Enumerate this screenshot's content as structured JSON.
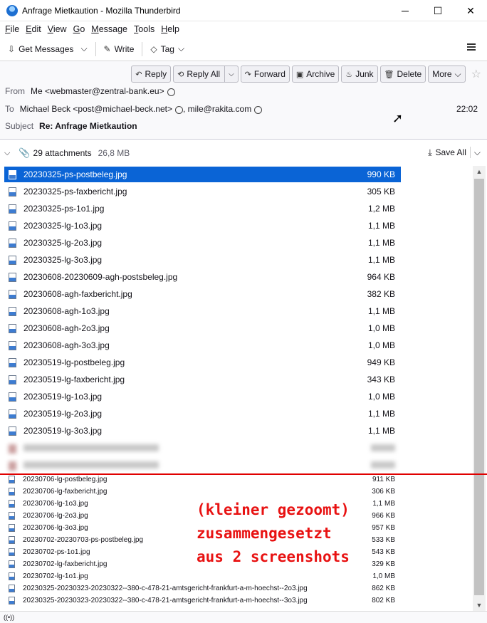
{
  "window": {
    "title": "Anfrage Mietkaution - Mozilla Thunderbird",
    "minimize": "─",
    "maximize": "☐",
    "close": "✕"
  },
  "menu": [
    "File",
    "Edit",
    "View",
    "Go",
    "Message",
    "Tools",
    "Help"
  ],
  "toolbar": {
    "get_messages": "Get Messages",
    "write": "Write",
    "tag": "Tag"
  },
  "actions": {
    "reply": "Reply",
    "reply_all": "Reply All",
    "forward": "Forward",
    "archive": "Archive",
    "junk": "Junk",
    "delete": "Delete",
    "more": "More"
  },
  "header": {
    "from_label": "From",
    "from_value": "Me <webmaster@zentral-bank.eu>",
    "to_label": "To",
    "to_value_1": "Michael Beck <post@michael-beck.net>",
    "to_value_2": ", mile@rakita.com",
    "subject_label": "Subject",
    "subject_value": "Re: Anfrage Mietkaution",
    "time": "22:02"
  },
  "attachments": {
    "count_label": "29 attachments",
    "total_size": "26,8 MB",
    "save_all": "Save All"
  },
  "files": [
    {
      "name": "20230325-ps-postbeleg.jpg",
      "size": "990 KB"
    },
    {
      "name": "20230325-ps-faxbericht.jpg",
      "size": "305 KB"
    },
    {
      "name": "20230325-ps-1o1.jpg",
      "size": "1,2 MB"
    },
    {
      "name": "20230325-lg-1o3.jpg",
      "size": "1,1 MB"
    },
    {
      "name": "20230325-lg-2o3.jpg",
      "size": "1,1 MB"
    },
    {
      "name": "20230325-lg-3o3.jpg",
      "size": "1,1 MB"
    },
    {
      "name": "20230608-20230609-agh-postsbeleg.jpg",
      "size": "964 KB"
    },
    {
      "name": "20230608-agh-faxbericht.jpg",
      "size": "382 KB"
    },
    {
      "name": "20230608-agh-1o3.jpg",
      "size": "1,1 MB"
    },
    {
      "name": "20230608-agh-2o3.jpg",
      "size": "1,0 MB"
    },
    {
      "name": "20230608-agh-3o3.jpg",
      "size": "1,0 MB"
    },
    {
      "name": "20230519-lg-postbeleg.jpg",
      "size": "949 KB"
    },
    {
      "name": "20230519-lg-faxbericht.jpg",
      "size": "343 KB"
    },
    {
      "name": "20230519-lg-1o3.jpg",
      "size": "1,0 MB"
    },
    {
      "name": "20230519-lg-2o3.jpg",
      "size": "1,1 MB"
    },
    {
      "name": "20230519-lg-3o3.jpg",
      "size": "1,1 MB"
    }
  ],
  "files_small": [
    {
      "name": "20230706-lg-postbeleg.jpg",
      "size": "911 KB"
    },
    {
      "name": "20230706-lg-faxbericht.jpg",
      "size": "306 KB"
    },
    {
      "name": "20230706-lg-1o3.jpg",
      "size": "1,1 MB"
    },
    {
      "name": "20230706-lg-2o3.jpg",
      "size": "966 KB"
    },
    {
      "name": "20230706-lg-3o3.jpg",
      "size": "957 KB"
    },
    {
      "name": "20230702-20230703-ps-postbeleg.jpg",
      "size": "533 KB"
    },
    {
      "name": "20230702-ps-1o1.jpg",
      "size": "543 KB"
    },
    {
      "name": "20230702-lg-faxbericht.jpg",
      "size": "329 KB"
    },
    {
      "name": "20230702-lg-1o1.jpg",
      "size": "1,0 MB"
    },
    {
      "name": "20230325-20230323-20230322--380-c-478-21-amtsgericht-frankfurt-a-m-hoechst--2o3.jpg",
      "size": "862 KB"
    },
    {
      "name": "20230325-20230323-20230322--380-c-478-21-amtsgericht-frankfurt-a-m-hoechst--3o3.jpg",
      "size": "802 KB"
    }
  ],
  "annotation": [
    "(kleiner gezoomt)",
    "zusammengesetzt",
    "aus 2 screenshots"
  ],
  "status": "((•))",
  "colors": {
    "selection": "#0a64d6",
    "annotation": "#e81212"
  }
}
